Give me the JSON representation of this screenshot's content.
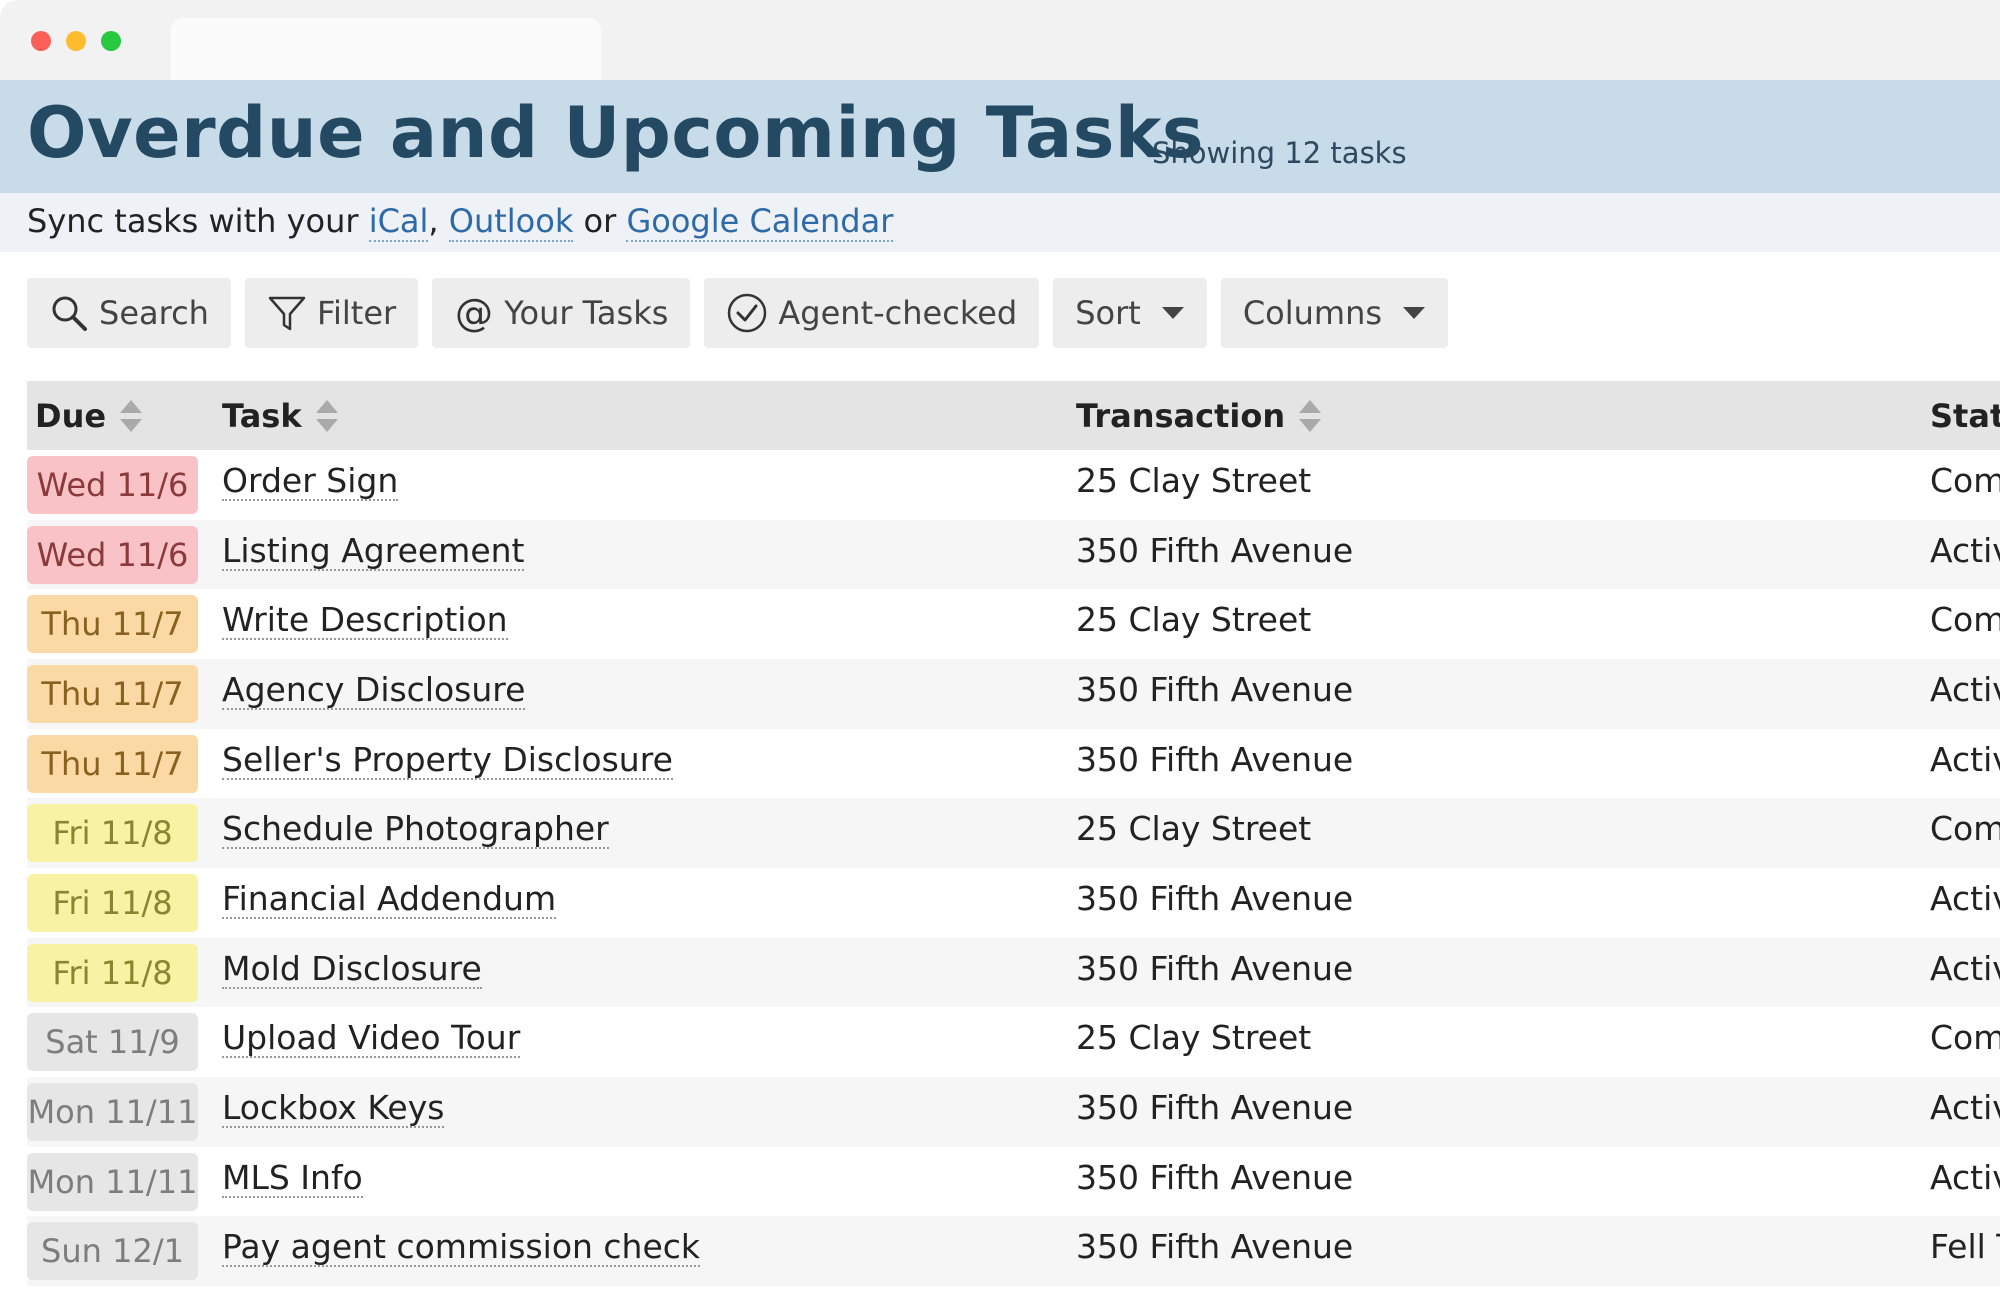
{
  "header": {
    "title": "Overdue and Upcoming Tasks",
    "count": "Showing 12 tasks"
  },
  "sync": {
    "prefix": "Sync tasks with your ",
    "ical": "iCal",
    "sep1": ", ",
    "outlook": "Outlook",
    "sep2": " or ",
    "google": "Google Calendar"
  },
  "toolbar": {
    "search": "Search",
    "filter": "Filter",
    "your_tasks": "Your Tasks",
    "agent_checked": "Agent-checked",
    "sort": "Sort",
    "columns": "Columns"
  },
  "table": {
    "headers": {
      "due": "Due",
      "task": "Task",
      "transaction": "Transaction",
      "status": "Statu"
    },
    "rows": [
      {
        "due": "Wed 11/6",
        "urgency": "red",
        "task": "Order Sign",
        "transaction": "25 Clay Street",
        "status": "Com"
      },
      {
        "due": "Wed 11/6",
        "urgency": "red",
        "task": "Listing Agreement",
        "transaction": "350 Fifth Avenue",
        "status": "Activ"
      },
      {
        "due": "Thu 11/7",
        "urgency": "orange",
        "task": "Write Description",
        "transaction": "25 Clay Street",
        "status": "Com"
      },
      {
        "due": "Thu 11/7",
        "urgency": "orange",
        "task": "Agency Disclosure",
        "transaction": "350 Fifth Avenue",
        "status": "Activ"
      },
      {
        "due": "Thu 11/7",
        "urgency": "orange",
        "task": "Seller's Property Disclosure",
        "transaction": "350 Fifth Avenue",
        "status": "Activ"
      },
      {
        "due": "Fri 11/8",
        "urgency": "yellow",
        "task": "Schedule Photographer",
        "transaction": "25 Clay Street",
        "status": "Com"
      },
      {
        "due": "Fri 11/8",
        "urgency": "yellow",
        "task": "Financial Addendum",
        "transaction": "350 Fifth Avenue",
        "status": "Activ"
      },
      {
        "due": "Fri 11/8",
        "urgency": "yellow",
        "task": "Mold Disclosure",
        "transaction": "350 Fifth Avenue",
        "status": "Activ"
      },
      {
        "due": "Sat 11/9",
        "urgency": "gray",
        "task": "Upload Video Tour",
        "transaction": "25 Clay Street",
        "status": "Com"
      },
      {
        "due": "Mon 11/11",
        "urgency": "gray",
        "task": "Lockbox Keys",
        "transaction": "350 Fifth Avenue",
        "status": "Activ"
      },
      {
        "due": "Mon 11/11",
        "urgency": "gray",
        "task": "MLS Info",
        "transaction": "350 Fifth Avenue",
        "status": "Activ"
      },
      {
        "due": "Sun 12/1",
        "urgency": "gray",
        "task": "Pay agent commission check",
        "transaction": "350 Fifth Avenue",
        "status": "Fell T"
      }
    ]
  },
  "colors": {
    "header_bg": "#c8dbe9",
    "title": "#244a63",
    "link": "#2d6aa7",
    "overdue": "#f8c2c6",
    "due_soon": "#fad9a4",
    "upcoming": "#f8f3a4",
    "later": "#e6e6e6"
  }
}
